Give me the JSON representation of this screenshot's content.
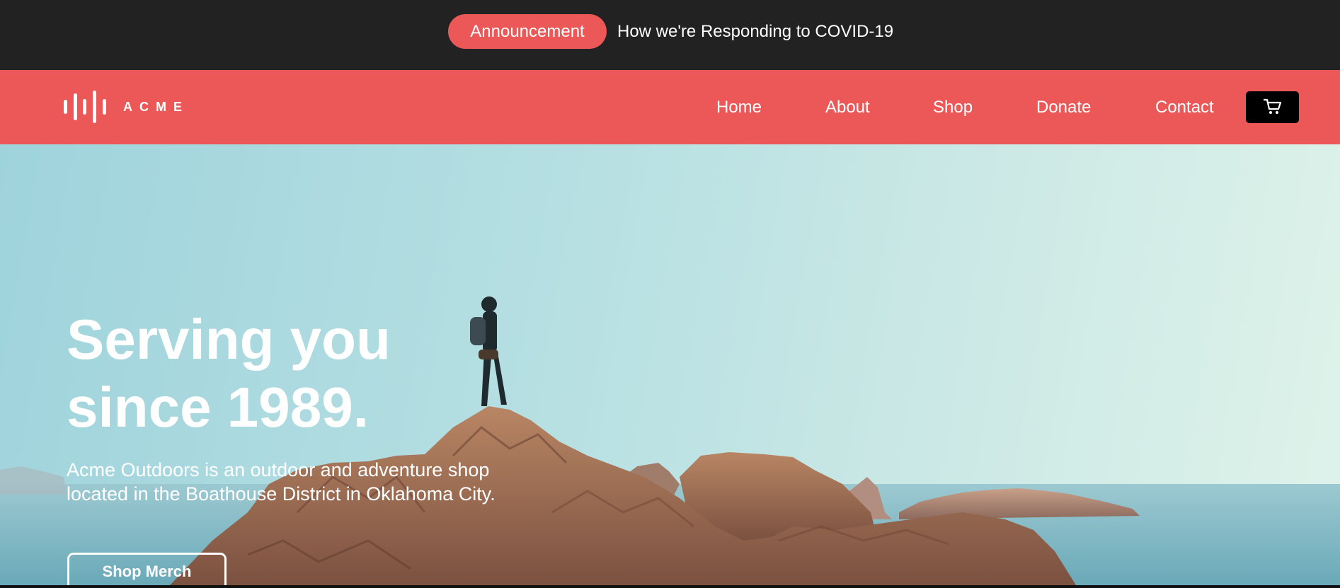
{
  "announcement": {
    "badge_label": "Announcement",
    "message": "How we're Responding to COVID-19"
  },
  "header": {
    "logo_text": "ACME",
    "nav": [
      {
        "label": "Home"
      },
      {
        "label": "About"
      },
      {
        "label": "Shop"
      },
      {
        "label": "Donate"
      },
      {
        "label": "Contact"
      }
    ],
    "cart_icon": "shopping-cart-icon"
  },
  "hero": {
    "title_line1": "Serving you",
    "title_line2": "since 1989.",
    "description": "Acme Outdoors is an outdoor and adventure shop located in the Boathouse District in Oklahoma City.",
    "cta_label": "Shop Merch"
  },
  "colors": {
    "brand": "#ec5757",
    "announce_bg": "#222222",
    "cart_bg": "#000000",
    "text": "#ffffff"
  }
}
